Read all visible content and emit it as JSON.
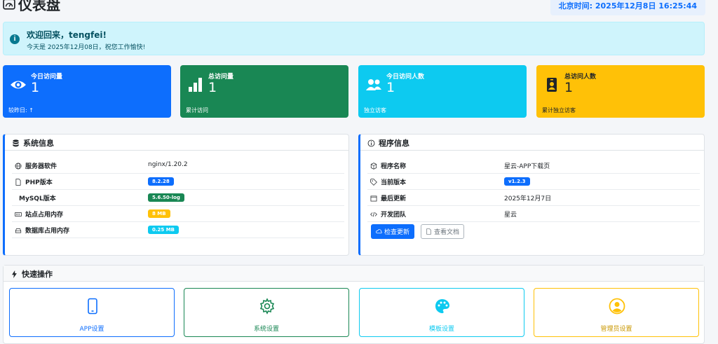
{
  "header": {
    "title": "仪表盘",
    "clock": "北京时间: 2025年12月8日 16:25:44"
  },
  "welcome": {
    "greeting": "欢迎回来，tengfei!",
    "subtitle": "今天是 2025年12月08日，祝您工作愉快!"
  },
  "stats": [
    {
      "label": "今日访问量",
      "value": "1",
      "footer": "较昨日: ↑",
      "color": "#0d6efd",
      "icon": "eye-icon"
    },
    {
      "label": "总访问量",
      "value": "1",
      "footer": "累计访问",
      "color": "#198754",
      "icon": "bar-chart-icon"
    },
    {
      "label": "今日访问人数",
      "value": "1",
      "footer": "独立访客",
      "color": "#0dcaf0",
      "icon": "users-icon"
    },
    {
      "label": "总访问人数",
      "value": "1",
      "footer": "累计独立访客",
      "color": "#ffc107",
      "icon": "person-badge-icon"
    }
  ],
  "system": {
    "title": "系统信息",
    "rows": [
      {
        "key": "服务器软件",
        "value": "nginx/1.20.2"
      },
      {
        "key": "PHP版本",
        "value": "8.2.28",
        "badge_color": "#0d6efd"
      },
      {
        "key": "MySQL版本",
        "value": "5.6.50-log",
        "badge_color": "#198754"
      },
      {
        "key": "站点占用内存",
        "value": "8 MB",
        "badge_color": "#ffc107"
      },
      {
        "key": "数据库占用内存",
        "value": "0.25 MB",
        "badge_color": "#0dcaf0"
      }
    ]
  },
  "program": {
    "title": "程序信息",
    "rows": [
      {
        "key": "程序名称",
        "value": "星云-APP下载页"
      },
      {
        "key": "当前版本",
        "value": "v1.2.3",
        "badge_color": "#0d6efd"
      },
      {
        "key": "最后更新",
        "value": "2025年12月7日"
      },
      {
        "key": "开发团队",
        "value": "星云"
      }
    ],
    "check_update_label": "检查更新",
    "view_docs_label": "查看文档"
  },
  "quick": {
    "title": "快速操作",
    "items": [
      {
        "label": "APP设置",
        "color": "#0d6efd",
        "icon": "phone-icon"
      },
      {
        "label": "系统设置",
        "color": "#198754",
        "icon": "gear-icon"
      },
      {
        "label": "模板设置",
        "color": "#0dcaf0",
        "icon": "palette-icon"
      },
      {
        "label": "管理员设置",
        "color": "#ffc107",
        "icon": "user-circle-icon"
      }
    ]
  }
}
